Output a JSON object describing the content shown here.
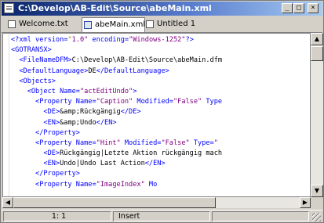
{
  "window": {
    "title": "C:\\Develop\\AB-Edit\\Source\\abeMain.xml",
    "controls": {
      "minimize": "_",
      "maximize": "□",
      "close": "×"
    }
  },
  "tabs": [
    {
      "label": "Welcome.txt",
      "icon": "text-file-icon"
    },
    {
      "label": "abeMain.xml",
      "icon": "xml-file-icon",
      "active": true
    },
    {
      "label": "Untitled 1",
      "icon": "text-file-icon"
    }
  ],
  "editor": {
    "lines": [
      [
        {
          "t": "<?xml version=",
          "c": "#0000ff"
        },
        {
          "t": "\"",
          "c": "#b8860b"
        },
        {
          "t": "1.0\"",
          "c": "#800080"
        },
        {
          "t": " encoding=",
          "c": "#0000ff"
        },
        {
          "t": "\"Windows-1252\"",
          "c": "#800080"
        },
        {
          "t": "?>",
          "c": "#0000ff"
        }
      ],
      [
        {
          "t": "<GOTRANSX>",
          "c": "#0000ff"
        }
      ],
      [
        {
          "t": "  <FileNameDFM>",
          "c": "#0000ff"
        },
        {
          "t": "C:\\Develop\\AB-Edit\\Source\\abeMain.dfm",
          "c": "#000000"
        }
      ],
      [
        {
          "t": "  <DefaultLanguage>",
          "c": "#0000ff"
        },
        {
          "t": "DE",
          "c": "#000000"
        },
        {
          "t": "</DefaultLanguage>",
          "c": "#0000ff"
        }
      ],
      [
        {
          "t": "  <Objects>",
          "c": "#0000ff"
        }
      ],
      [
        {
          "t": "    <Object Name=",
          "c": "#0000ff"
        },
        {
          "t": "\"actEditUndo\"",
          "c": "#800080"
        },
        {
          "t": ">",
          "c": "#0000ff"
        }
      ],
      [
        {
          "t": "      <Property Name=",
          "c": "#0000ff"
        },
        {
          "t": "\"Caption\"",
          "c": "#800080"
        },
        {
          "t": " Modified=",
          "c": "#0000ff"
        },
        {
          "t": "\"False\"",
          "c": "#800080"
        },
        {
          "t": " Type",
          "c": "#0000ff"
        }
      ],
      [
        {
          "t": "        <DE>",
          "c": "#0000ff"
        },
        {
          "t": "&amp;Rückgängig",
          "c": "#000000"
        },
        {
          "t": "</DE>",
          "c": "#0000ff"
        }
      ],
      [
        {
          "t": "        <EN>",
          "c": "#0000ff"
        },
        {
          "t": "&amp;Undo",
          "c": "#000000"
        },
        {
          "t": "</EN>",
          "c": "#0000ff"
        }
      ],
      [
        {
          "t": "      </Property>",
          "c": "#0000ff"
        }
      ],
      [
        {
          "t": "      <Property Name=",
          "c": "#0000ff"
        },
        {
          "t": "\"Hint\"",
          "c": "#800080"
        },
        {
          "t": " Modified=",
          "c": "#0000ff"
        },
        {
          "t": "\"False\"",
          "c": "#800080"
        },
        {
          "t": " Type=",
          "c": "#0000ff"
        },
        {
          "t": "\"",
          "c": "#800080"
        }
      ],
      [
        {
          "t": "        <DE>",
          "c": "#0000ff"
        },
        {
          "t": "Rückgängig|Letzte Aktion rückgängig mach",
          "c": "#000000"
        }
      ],
      [
        {
          "t": "        <EN>",
          "c": "#0000ff"
        },
        {
          "t": "Undo|Undo Last Action",
          "c": "#000000"
        },
        {
          "t": "</EN>",
          "c": "#0000ff"
        }
      ],
      [
        {
          "t": "      </Property>",
          "c": "#0000ff"
        }
      ],
      [
        {
          "t": "      <Property Name=",
          "c": "#0000ff"
        },
        {
          "t": "\"ImageIndex\"",
          "c": "#800080"
        },
        {
          "t": " Mo",
          "c": "#0000ff"
        }
      ]
    ]
  },
  "status": {
    "position": "1: 1",
    "mode": "Insert"
  },
  "scroll": {
    "up": "▲",
    "down": "▼",
    "left": "◀",
    "right": "▶"
  },
  "colors": {
    "tag": "#0000ff",
    "attr_value": "#800080",
    "text": "#000000",
    "title_start": "#0a246a",
    "title_end": "#a6caf0"
  }
}
